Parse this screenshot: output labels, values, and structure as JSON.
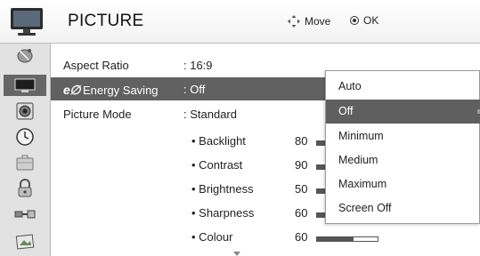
{
  "header": {
    "title": "PICTURE",
    "move_label": "Move",
    "ok_label": "OK"
  },
  "sidebar": {
    "items": [
      {
        "icon": "satellite-dish-icon"
      },
      {
        "icon": "tv-screen-icon",
        "active": true
      },
      {
        "icon": "speaker-icon"
      },
      {
        "icon": "clock-icon"
      },
      {
        "icon": "suitcase-icon"
      },
      {
        "icon": "padlock-icon"
      },
      {
        "icon": "input-cable-icon"
      },
      {
        "icon": "photo-icon"
      }
    ]
  },
  "rows": [
    {
      "label": "Aspect Ratio",
      "value": ": 16:9"
    },
    {
      "logo": "e∅",
      "label": "Energy Saving",
      "value": ": Off",
      "selected": true
    },
    {
      "label": "Picture Mode",
      "value": ": Standard"
    }
  ],
  "subrows": [
    {
      "label": "• Backlight",
      "value": "80",
      "level": 0.8
    },
    {
      "label": "• Contrast",
      "value": "90",
      "level": 0.9
    },
    {
      "label": "• Brightness",
      "value": "50",
      "level": 0.5
    },
    {
      "label": "• Sharpness",
      "value": "60",
      "level": 0.6
    },
    {
      "label": "• Colour",
      "value": "60",
      "level": 0.6
    }
  ],
  "popup": {
    "options": [
      {
        "label": "Auto"
      },
      {
        "label": "Off",
        "selected": true
      },
      {
        "label": "Minimum"
      },
      {
        "label": "Medium"
      },
      {
        "label": "Maximum"
      },
      {
        "label": "Screen Off"
      }
    ]
  },
  "colors": {
    "selected_bg": "#616161",
    "panel_bg": "#ffffff",
    "sidebar_bg": "#e2e2e2"
  }
}
